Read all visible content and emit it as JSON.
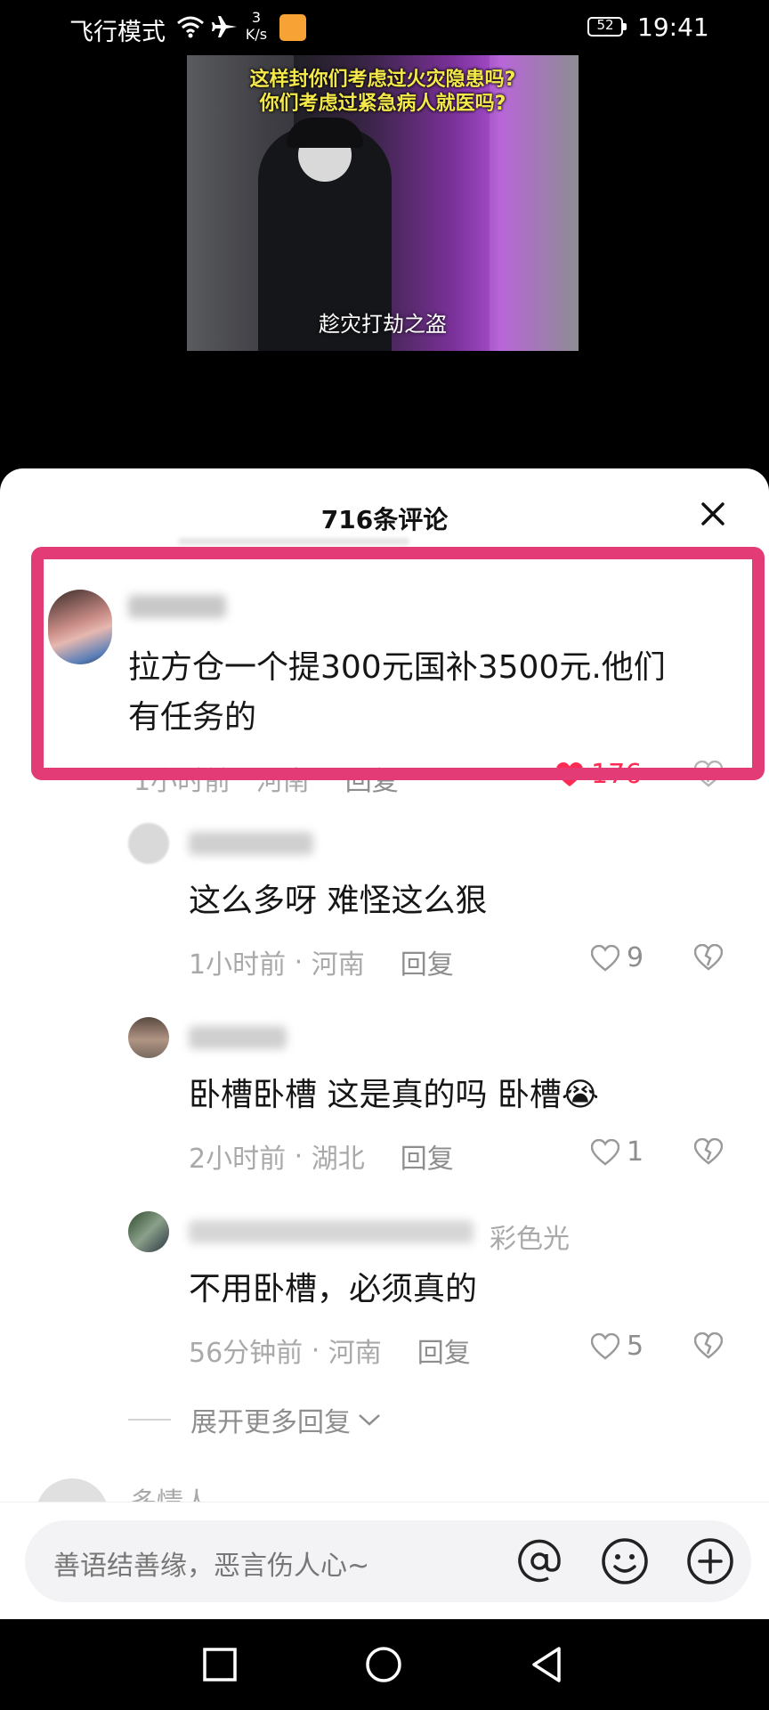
{
  "status": {
    "mode": "飞行模式",
    "speed_value": "3",
    "speed_unit": "K/s",
    "battery": "52",
    "time": "19:41"
  },
  "video": {
    "caption_line1": "这样封你们考虑过火灾隐患吗?",
    "caption_line2": "你们考虑过紧急病人就医吗?",
    "subtitle": "趁灾打劫之盗"
  },
  "sheet": {
    "title": "716条评论"
  },
  "comments": [
    {
      "text_line1": "拉方仓一个提300元国补3500元.他们",
      "text_line2": "有任务的",
      "time": "1小时前",
      "location": "河南",
      "reply": "回复",
      "likes": "176",
      "liked": true
    },
    {
      "text": "这么多呀 难怪这么狠",
      "time": "1小时前",
      "location": "河南",
      "reply": "回复",
      "likes": "9"
    },
    {
      "text": "卧槽卧槽 这是真的吗 卧槽",
      "emoji": "😭",
      "time": "2小时前",
      "location": "湖北",
      "reply": "回复",
      "likes": "1"
    },
    {
      "name_partial": "彩色光",
      "text": "不用卧槽，必须真的",
      "time": "56分钟前",
      "location": "河南",
      "reply": "回复",
      "likes": "5"
    }
  ],
  "expand_more": "展开更多回复",
  "next_commenter_partial": "多情人",
  "input": {
    "placeholder": "善语结善缘，恶言伤人心~"
  },
  "colors": {
    "highlight": "#e33b75",
    "like_red": "#fe2c55"
  },
  "icons": [
    "wifi-icon",
    "airplane-icon",
    "close-icon",
    "heart-icon",
    "broken-heart-icon",
    "at-icon",
    "emoji-icon",
    "add-icon",
    "square-nav-icon",
    "circle-nav-icon",
    "back-nav-icon"
  ]
}
